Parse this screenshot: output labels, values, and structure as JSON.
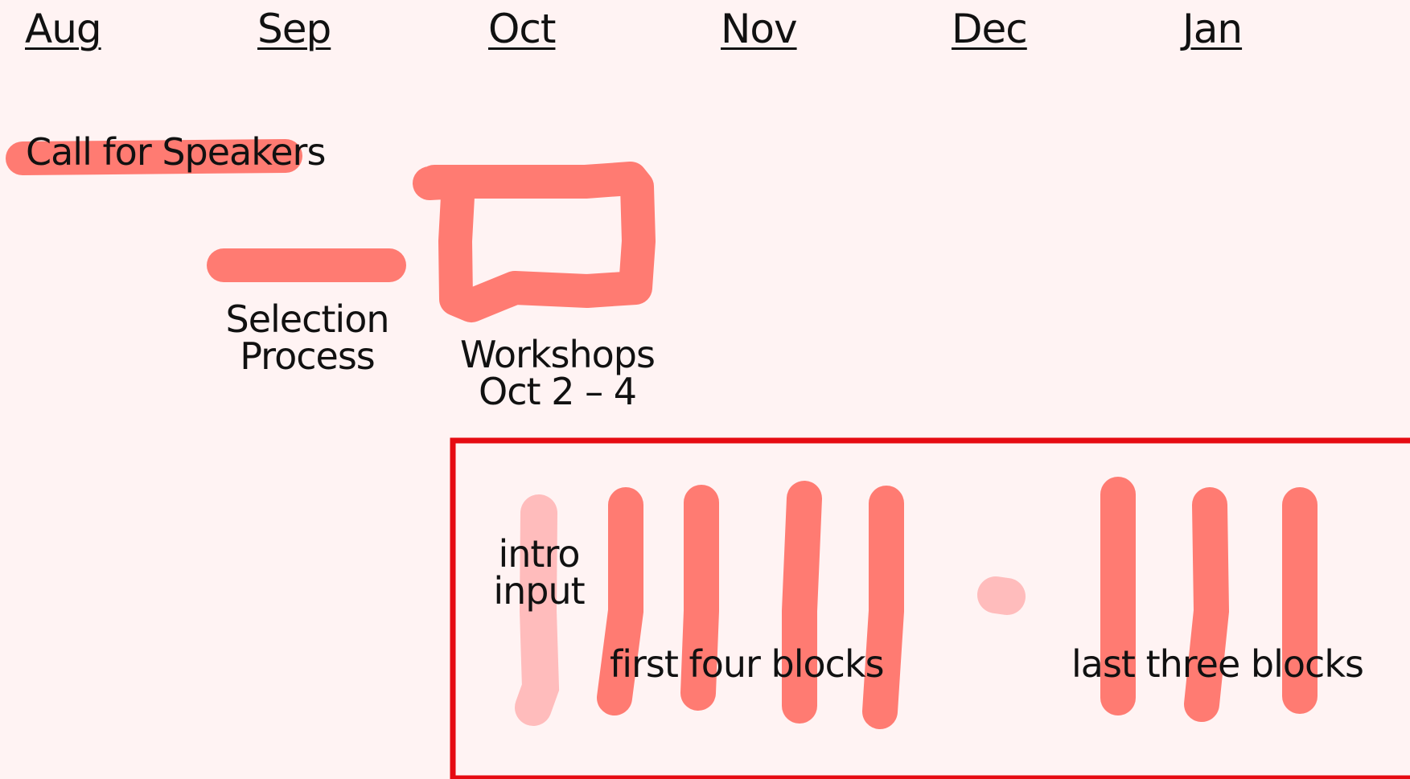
{
  "months": [
    "Aug",
    "Sep",
    "Oct",
    "Nov",
    "Dec",
    "Jan"
  ],
  "labels": {
    "call_for_speakers": "Call for Speakers",
    "selection_process": [
      "Selection",
      "Process"
    ],
    "workshops": [
      "Workshops",
      "Oct 2 – 4"
    ],
    "intro_input": [
      "intro",
      "input"
    ],
    "first_four_blocks": "first four blocks",
    "last_three_blocks": "last three blocks"
  },
  "colors": {
    "stroke": "#ff7b72",
    "stroke_light": "#ffbcbc",
    "frame": "#e60b12",
    "background": "#fff3f3"
  }
}
